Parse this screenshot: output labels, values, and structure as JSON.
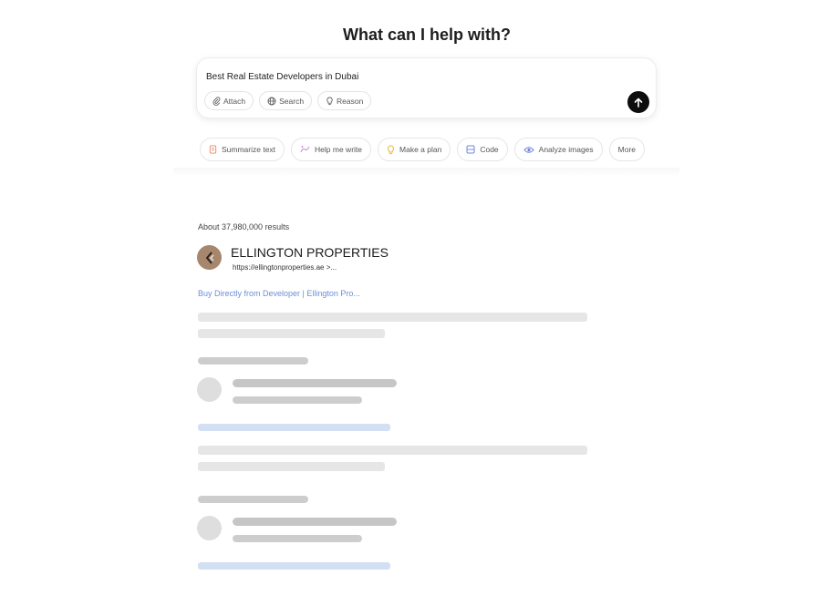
{
  "heading": "What can I help with?",
  "composer": {
    "query": "Best Real Estate Developers in Dubai",
    "tools": [
      {
        "label": "Attach",
        "icon": "paperclip-icon"
      },
      {
        "label": "Search",
        "icon": "globe-icon"
      },
      {
        "label": "Reason",
        "icon": "lightbulb-icon"
      }
    ],
    "send_icon": "arrow-up-icon"
  },
  "suggestions": [
    {
      "label": "Summarize text",
      "icon": "document-icon",
      "color": "#e8866a"
    },
    {
      "label": "Help me write",
      "icon": "pen-icon",
      "color": "#c98ad6"
    },
    {
      "label": "Make a plan",
      "icon": "lightbulb-icon",
      "color": "#e6b93b"
    },
    {
      "label": "Code",
      "icon": "code-icon",
      "color": "#6f86d9"
    },
    {
      "label": "Analyze images",
      "icon": "eye-icon",
      "color": "#6f86d9"
    },
    {
      "label": "More",
      "icon": "",
      "color": "#555555"
    }
  ],
  "results": {
    "count_text": "About 37,980,000 results",
    "first": {
      "name": "ELLINGTON PROPERTIES",
      "url": "https://ellingtonproperties.ae >...",
      "link_text": "Buy Directly from Developer | Ellington Pro..."
    }
  }
}
